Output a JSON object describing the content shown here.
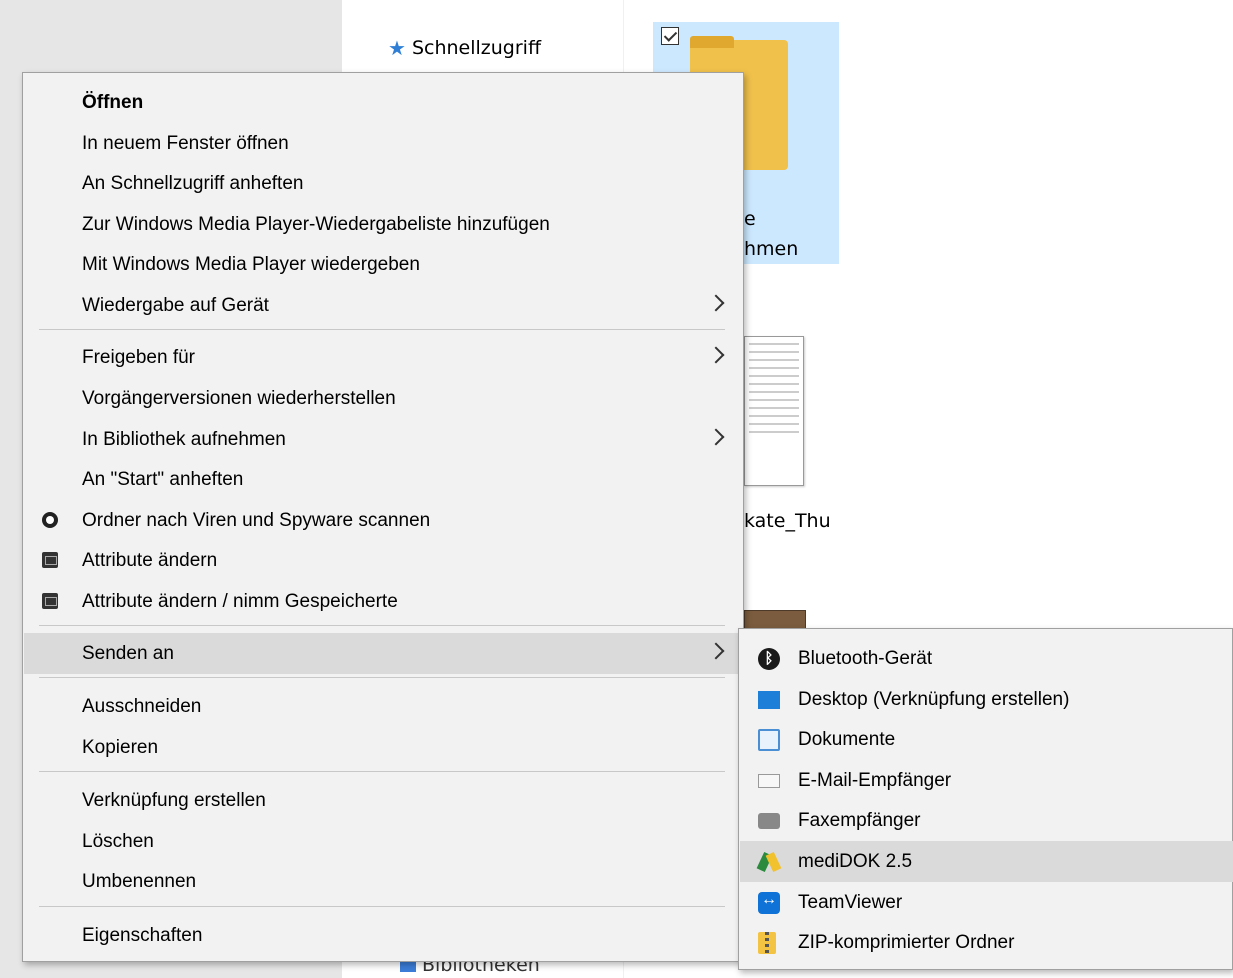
{
  "explorer": {
    "quick_access": "Schnellzugriff",
    "bottom_item": "Bibliotheken",
    "folder_label_line1": "e",
    "folder_label_line2": "hmen",
    "file_label": "kate_Thu"
  },
  "context_menu": {
    "items": [
      {
        "label": "Öffnen"
      },
      {
        "label": "In neuem Fenster öffnen"
      },
      {
        "label": "An Schnellzugriff anheften"
      },
      {
        "label": "Zur Windows Media Player-Wiedergabeliste hinzufügen"
      },
      {
        "label": "Mit Windows Media Player wiedergeben"
      },
      {
        "label": "Wiedergabe auf Gerät"
      },
      {
        "label": "Freigeben für"
      },
      {
        "label": "Vorgängerversionen wiederherstellen"
      },
      {
        "label": "In Bibliothek aufnehmen"
      },
      {
        "label": "An \"Start\" anheften"
      },
      {
        "label": "Ordner nach Viren und Spyware scannen",
        "icon": "defender-icon"
      },
      {
        "label": "Attribute ändern",
        "icon": "attribute-icon"
      },
      {
        "label": "Attribute ändern / nimm Gespeicherte",
        "icon": "attribute-icon"
      },
      {
        "label": "Senden an"
      },
      {
        "label": "Ausschneiden"
      },
      {
        "label": "Kopieren"
      },
      {
        "label": "Verknüpfung erstellen"
      },
      {
        "label": "Löschen"
      },
      {
        "label": "Umbenennen"
      },
      {
        "label": "Eigenschaften"
      }
    ]
  },
  "send_to_menu": {
    "items": [
      {
        "label": "Bluetooth-Gerät",
        "icon": "bluetooth-icon"
      },
      {
        "label": "Desktop (Verknüpfung erstellen)",
        "icon": "desktop-icon"
      },
      {
        "label": "Dokumente",
        "icon": "documents-icon"
      },
      {
        "label": "E-Mail-Empfänger",
        "icon": "mail-icon"
      },
      {
        "label": "Faxempfänger",
        "icon": "fax-icon"
      },
      {
        "label": "mediDOK 2.5",
        "icon": "medidok-icon"
      },
      {
        "label": "TeamViewer",
        "icon": "teamviewer-icon"
      },
      {
        "label": "ZIP-komprimierter Ordner",
        "icon": "zip-folder-icon"
      }
    ]
  }
}
